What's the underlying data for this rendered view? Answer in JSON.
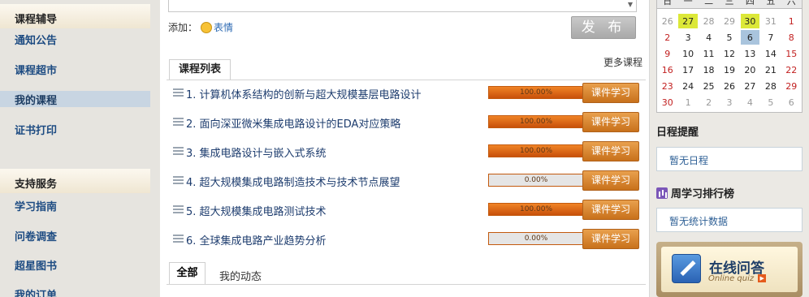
{
  "sidebar": {
    "sections": [
      {
        "title": "课程辅导",
        "items": [
          {
            "label": "通知公告",
            "active": false
          },
          {
            "label": "课程超市",
            "active": false
          },
          {
            "label": "我的课程",
            "active": true
          },
          {
            "label": "证书打印",
            "active": false
          }
        ]
      },
      {
        "title": "支持服务",
        "items": [
          {
            "label": "学习指南",
            "active": false
          },
          {
            "label": "问卷调查",
            "active": false
          },
          {
            "label": "超星图书",
            "active": false
          },
          {
            "label": "我的订单",
            "active": false
          }
        ]
      }
    ]
  },
  "editor": {
    "add_label": "添加：",
    "emoticon_label": "表情",
    "publish_label": "发 布"
  },
  "course_list": {
    "tab_label": "课程列表",
    "more_label": "更多课程",
    "courses": [
      {
        "title": "1. 计算机体系结构的创新与超大规模基层电路设计",
        "progress_text": "100.00%",
        "progress": 1.0,
        "button": "课件学习"
      },
      {
        "title": "2. 面向深亚微米集成电路设计的EDA对应策略",
        "progress_text": "100.00%",
        "progress": 1.0,
        "button": "课件学习"
      },
      {
        "title": "3. 集成电路设计与嵌入式系统",
        "progress_text": "100.00%",
        "progress": 1.0,
        "button": "课件学习"
      },
      {
        "title": "4. 超大规模集成电路制造技术与技术节点展望",
        "progress_text": "0.00%",
        "progress": 0.0,
        "button": "课件学习"
      },
      {
        "title": "5. 超大规模集成电路测试技术",
        "progress_text": "100.00%",
        "progress": 1.0,
        "button": "课件学习"
      },
      {
        "title": "6. 全球集成电路产业趋势分析",
        "progress_text": "0.00%",
        "progress": 0.0,
        "button": "课件学习"
      }
    ]
  },
  "activity_tabs": {
    "all_label": "全部",
    "mine_label": "我的动态"
  },
  "calendar": {
    "weekdays": [
      "日",
      "一",
      "二",
      "三",
      "四",
      "五",
      "六"
    ],
    "days": [
      {
        "d": "26",
        "type": "grey"
      },
      {
        "d": "27",
        "type": "hl"
      },
      {
        "d": "28",
        "type": "grey"
      },
      {
        "d": "29",
        "type": "grey"
      },
      {
        "d": "30",
        "type": "hl"
      },
      {
        "d": "31",
        "type": "grey"
      },
      {
        "d": "1",
        "type": "red"
      },
      {
        "d": "2",
        "type": "red"
      },
      {
        "d": "3",
        "type": "normal"
      },
      {
        "d": "4",
        "type": "normal"
      },
      {
        "d": "5",
        "type": "normal"
      },
      {
        "d": "6",
        "type": "today"
      },
      {
        "d": "7",
        "type": "normal"
      },
      {
        "d": "8",
        "type": "red"
      },
      {
        "d": "9",
        "type": "red"
      },
      {
        "d": "10",
        "type": "normal"
      },
      {
        "d": "11",
        "type": "normal"
      },
      {
        "d": "12",
        "type": "normal"
      },
      {
        "d": "13",
        "type": "normal"
      },
      {
        "d": "14",
        "type": "normal"
      },
      {
        "d": "15",
        "type": "red"
      },
      {
        "d": "16",
        "type": "red"
      },
      {
        "d": "17",
        "type": "normal"
      },
      {
        "d": "18",
        "type": "normal"
      },
      {
        "d": "19",
        "type": "normal"
      },
      {
        "d": "20",
        "type": "normal"
      },
      {
        "d": "21",
        "type": "normal"
      },
      {
        "d": "22",
        "type": "red"
      },
      {
        "d": "23",
        "type": "red"
      },
      {
        "d": "24",
        "type": "normal"
      },
      {
        "d": "25",
        "type": "normal"
      },
      {
        "d": "26",
        "type": "normal"
      },
      {
        "d": "27",
        "type": "normal"
      },
      {
        "d": "28",
        "type": "normal"
      },
      {
        "d": "29",
        "type": "red"
      },
      {
        "d": "30",
        "type": "red"
      },
      {
        "d": "1",
        "type": "grey"
      },
      {
        "d": "2",
        "type": "grey"
      },
      {
        "d": "3",
        "type": "grey"
      },
      {
        "d": "4",
        "type": "grey"
      },
      {
        "d": "5",
        "type": "grey"
      },
      {
        "d": "6",
        "type": "grey"
      }
    ]
  },
  "schedule": {
    "title": "日程提醒",
    "empty": "暂无日程"
  },
  "ranking": {
    "title": "周学习排行榜",
    "empty": "暂无统计数据"
  },
  "qa_banner": {
    "title": "在线问答",
    "subtitle": "Online quiz"
  }
}
